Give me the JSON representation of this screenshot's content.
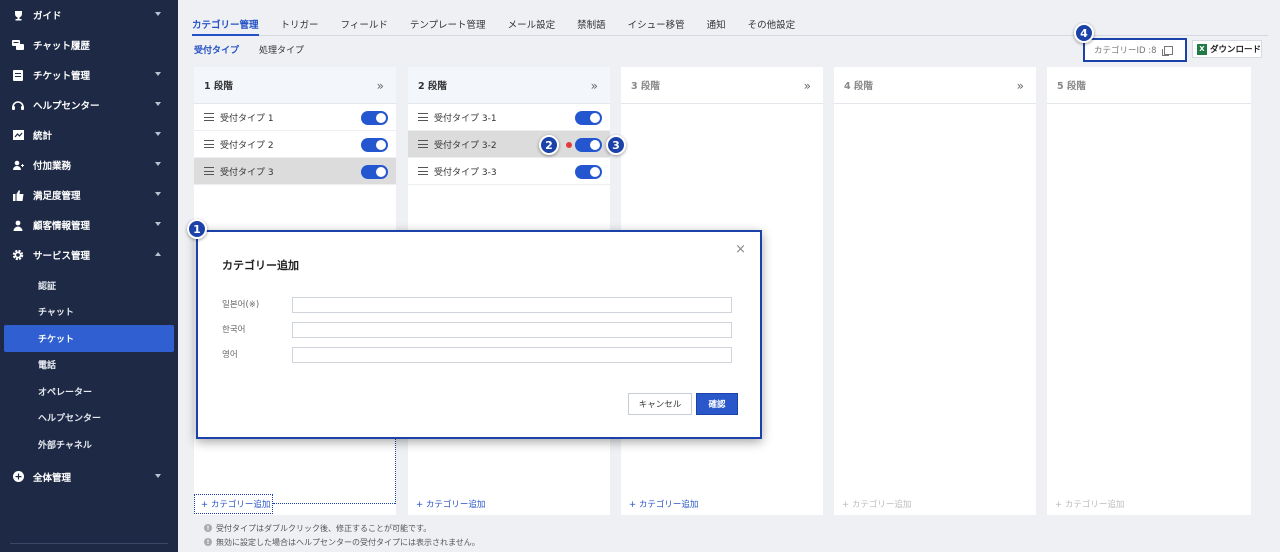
{
  "sidebar": {
    "items": [
      {
        "label": "ガイド",
        "icon": "trophy-icon"
      },
      {
        "label": "チャット履歴",
        "icon": "chat-icon"
      },
      {
        "label": "チケット管理",
        "icon": "ticket-icon"
      },
      {
        "label": "ヘルプセンター",
        "icon": "headset-icon"
      },
      {
        "label": "統計",
        "icon": "chart-icon"
      },
      {
        "label": "付加業務",
        "icon": "user-plus-icon"
      },
      {
        "label": "満足度管理",
        "icon": "thumbs-up-icon"
      },
      {
        "label": "顧客情報管理",
        "icon": "user-icon"
      },
      {
        "label": "サービス管理",
        "icon": "gear-icon"
      }
    ],
    "service_sub": [
      "認証",
      "チャット",
      "チケット",
      "電話",
      "オペレーター",
      "ヘルプセンター",
      "外部チャネル"
    ],
    "all_admin": "全体管理"
  },
  "tabs": [
    "カテゴリー管理",
    "トリガー",
    "フィールド",
    "テンプレート管理",
    "メール設定",
    "禁制語",
    "イシュー移管",
    "通知",
    "その他設定"
  ],
  "subtabs": [
    "受付タイプ",
    "処理タイプ"
  ],
  "toolbar": {
    "category_id": "カテゴリーID :8",
    "download": "ダウンロード",
    "xls": "X"
  },
  "columns": [
    {
      "title": "1 段階",
      "items": [
        "受付タイプ 1",
        "受付タイプ 2",
        "受付タイプ 3"
      ]
    },
    {
      "title": "2 段階",
      "items": [
        "受付タイプ 3-1",
        "受付タイプ 3-2",
        "受付タイプ 3-3"
      ]
    },
    {
      "title": "3 段階",
      "items": []
    },
    {
      "title": "4 段階",
      "items": []
    },
    {
      "title": "5 段階",
      "items": []
    }
  ],
  "expand_glyph": "»",
  "add_category": "+ カテゴリー追加",
  "notes": [
    "受付タイプはダブルクリック後、修正することが可能です。",
    "無効に設定した場合はヘルプセンターの受付タイプには表示されません。"
  ],
  "modal": {
    "title": "カテゴリー追加",
    "close": "×",
    "fields": [
      "일본어(※)",
      "한국어",
      "영어"
    ],
    "cancel": "キャンセル",
    "confirm": "確認"
  },
  "badges": [
    "1",
    "2",
    "3",
    "4"
  ]
}
